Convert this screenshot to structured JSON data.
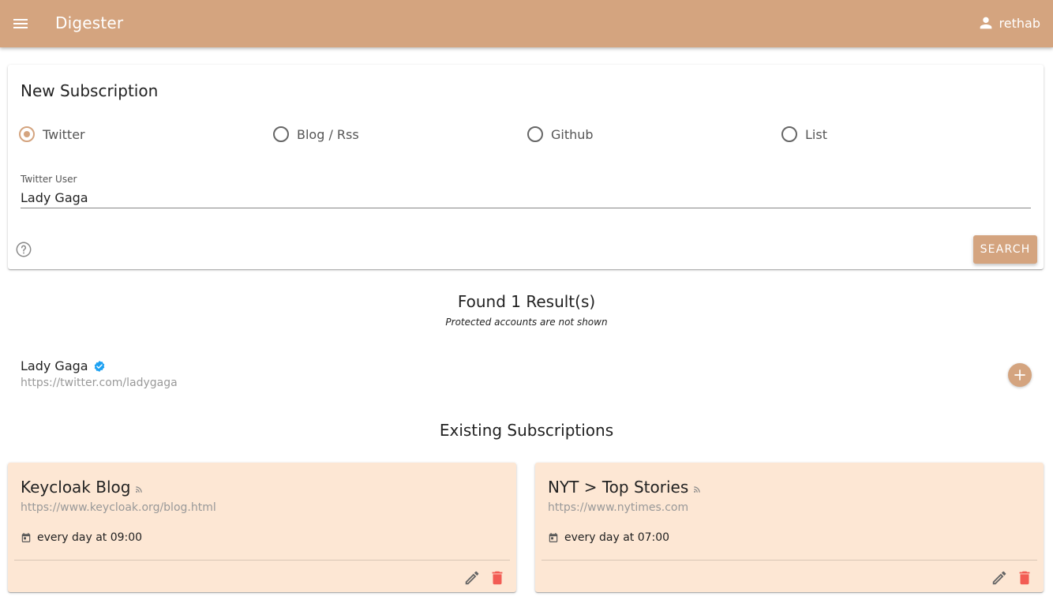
{
  "header": {
    "menu_icon": "hamburger-menu-icon",
    "title": "Digester",
    "user_icon": "person-icon",
    "username": "rethab",
    "bar_color": "#d4a47f"
  },
  "new_subscription": {
    "title": "New Subscription",
    "types": [
      {
        "label": "Twitter",
        "checked": true
      },
      {
        "label": "Blog / Rss",
        "checked": false
      },
      {
        "label": "Github",
        "checked": false
      },
      {
        "label": "List",
        "checked": false
      }
    ],
    "field_label": "Twitter User",
    "field_value": "Lady Gaga",
    "help_icon": "help-circle-icon",
    "search_label": "SEARCH"
  },
  "results": {
    "title": "Found 1 Result(s)",
    "note": "Protected accounts are not shown",
    "items": [
      {
        "name": "Lady Gaga",
        "verified": true,
        "url": "https://twitter.com/ladygaga"
      }
    ]
  },
  "existing": {
    "title": "Existing Subscriptions",
    "items": [
      {
        "title": "Keycloak Blog",
        "type_icon": "rss-icon",
        "url": "https://www.keycloak.org/blog.html",
        "schedule": "every day at 09:00"
      },
      {
        "title": "NYT > Top Stories",
        "type_icon": "rss-icon",
        "url": "https://www.nytimes.com",
        "schedule": "every day at 07:00"
      }
    ]
  },
  "colors": {
    "accent": "#d4a47f",
    "card_bg": "#fde7d4",
    "delete": "#f25c54",
    "verified": "#1da1f2"
  }
}
